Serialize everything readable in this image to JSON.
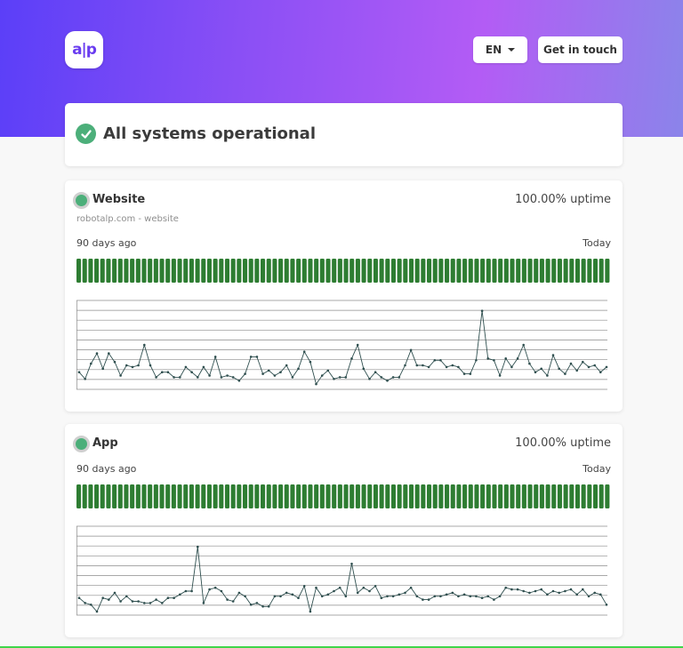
{
  "header": {
    "logo_text": "a|p",
    "language_label": "EN",
    "contact_label": "Get in touch"
  },
  "status": {
    "title": "All systems operational"
  },
  "services": [
    {
      "name": "Website",
      "subtitle": "robotalp.com - website",
      "uptime": "100.00% uptime",
      "range_start": "90 days ago",
      "range_end": "Today",
      "uptime_bars": 90,
      "response_times": [
        8,
        4,
        13,
        19,
        10,
        19,
        14,
        6,
        12,
        11,
        12,
        24,
        12,
        5,
        8,
        8,
        5,
        5,
        11,
        8,
        5,
        11,
        6,
        17,
        5,
        6,
        5,
        3,
        7,
        17,
        17,
        7,
        9,
        6,
        8,
        12,
        5,
        10,
        20,
        14,
        1,
        6,
        9,
        4,
        5,
        5,
        16,
        24,
        10,
        4,
        8,
        5,
        3,
        5,
        5,
        12,
        21,
        12,
        12,
        11,
        15,
        15,
        11,
        12,
        11,
        7,
        7,
        15,
        44,
        16,
        15,
        6,
        16,
        11,
        16,
        24,
        13,
        8,
        10,
        6,
        18,
        10,
        7,
        13,
        9,
        14,
        11,
        12,
        8,
        11
      ],
      "bar_color": "#2e7d32"
    },
    {
      "name": "App",
      "uptime": "100.00% uptime",
      "range_start": "90 days ago",
      "range_end": "Today",
      "uptime_bars": 90,
      "response_times": [
        8,
        5,
        4,
        0,
        8,
        7,
        11,
        6,
        9,
        6,
        6,
        5,
        5,
        7,
        5,
        8,
        8,
        10,
        12,
        12,
        38,
        5,
        13,
        14,
        12,
        7,
        6,
        11,
        9,
        4,
        5,
        3,
        3,
        9,
        9,
        11,
        10,
        8,
        15,
        0,
        14,
        9,
        10,
        12,
        14,
        9,
        28,
        11,
        14,
        12,
        15,
        8,
        9,
        9,
        10,
        11,
        14,
        9,
        7,
        7,
        9,
        9,
        10,
        11,
        9,
        10,
        9,
        9,
        8,
        9,
        7,
        9,
        14,
        13,
        13,
        12,
        11,
        12,
        13,
        10,
        12,
        11,
        12,
        13,
        10,
        13,
        9,
        11,
        10,
        4
      ],
      "bar_color": "#2e7d32"
    }
  ],
  "colors": {
    "accent": "#4caf7a",
    "gradient_start": "#5b3ff8",
    "gradient_end": "#b35cf5",
    "chart_line": "#2f4f4f"
  }
}
